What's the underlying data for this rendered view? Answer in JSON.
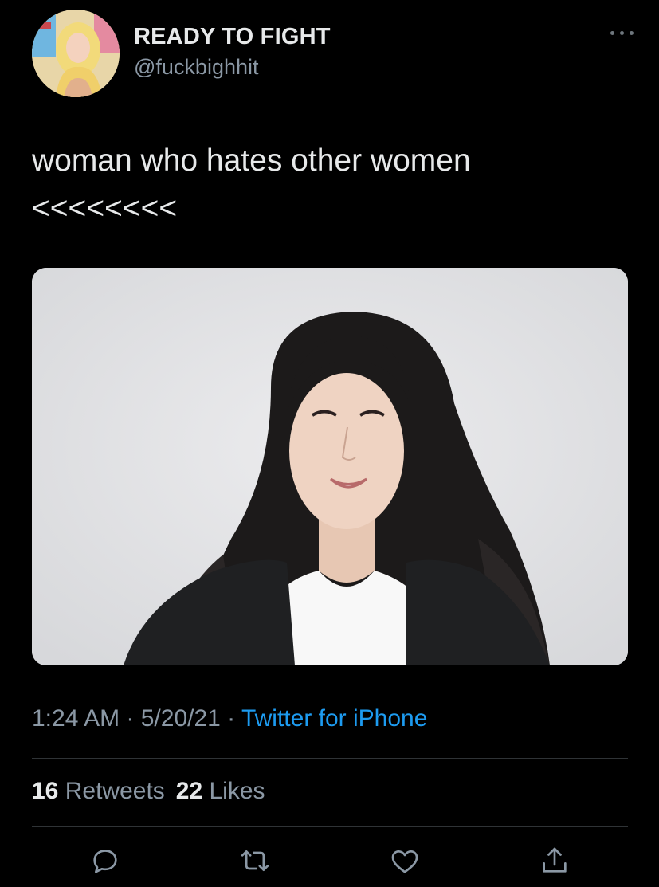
{
  "author": {
    "display_name": "READY TO FIGHT",
    "handle": "@fuckbighhit",
    "avatar_icon": "avatar-photo"
  },
  "menu": {
    "icon": "more-dots-icon"
  },
  "tweet": {
    "line1": "woman who hates other women",
    "line2": "<<<<<<<<"
  },
  "media": {
    "icon": "photo-portrait"
  },
  "meta": {
    "time": "1:24 AM",
    "sep1": " · ",
    "date": "5/20/21",
    "sep2": " · ",
    "source": "Twitter for iPhone"
  },
  "stats": {
    "retweets_count": "16",
    "retweets_label": "Retweets",
    "likes_count": "22",
    "likes_label": "Likes"
  },
  "actions": [
    "reply-icon",
    "retweet-icon",
    "like-icon",
    "share-icon"
  ],
  "colors": {
    "background": "#000000",
    "text": "#e7e9ea",
    "muted": "#8b98a5",
    "link": "#1d9bf0",
    "divider": "#2f3336"
  }
}
